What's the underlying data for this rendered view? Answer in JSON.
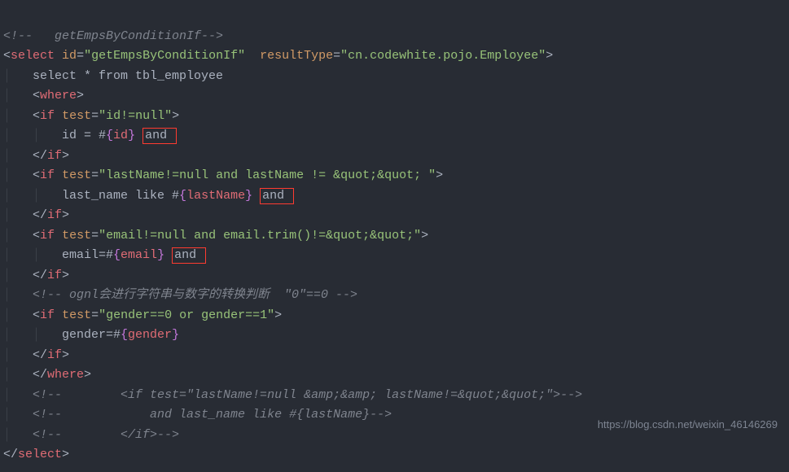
{
  "line1_comment": "<!--   getEmpsByConditionIf-->",
  "select_tag_open": "<",
  "select_tag_name": "select",
  "attr_id_name": "id",
  "attr_id_value": "\"getEmpsByConditionIf\"",
  "attr_resultType_name": "resultType",
  "attr_resultType_value": "\"cn.codewhite.pojo.Employee\"",
  "tag_close_open": ">",
  "sql_select": "select * from tbl_employee",
  "where_open": "<",
  "where_name": "where",
  "if_name": "if",
  "attr_test_name": "test",
  "test1_value": "\"id!=null\"",
  "if1_body_pre": "id = #",
  "if1_var": "id",
  "and_text": "and ",
  "if_close": "if",
  "test2_value": "\"lastName!=null and lastName != &quot;&quot; \"",
  "if2_body_pre": "last_name like #",
  "if2_var": "lastName",
  "test3_value": "\"email!=null and email.trim()!=&quot;&quot;\"",
  "if3_body_pre": " email=#",
  "if3_var": "email",
  "comment_ognl": "<!-- ognl会进行字符串与数字的转换判断  \"0\"==0 -->",
  "test4_value": "\"gender==0 or gender==1\"",
  "if4_body_pre": "gender=#",
  "if4_var": "gender",
  "where_close": "where",
  "tail_c1": "<!--        <if test=\"lastName!=null &amp;&amp; lastName!=&quot;&quot;\">-->",
  "tail_c2": "<!--            and last_name like #{lastName}-->",
  "tail_c3": "<!--        </if>-->",
  "watermark": "https://blog.csdn.net/weixin_46146269",
  "chart_data": null
}
